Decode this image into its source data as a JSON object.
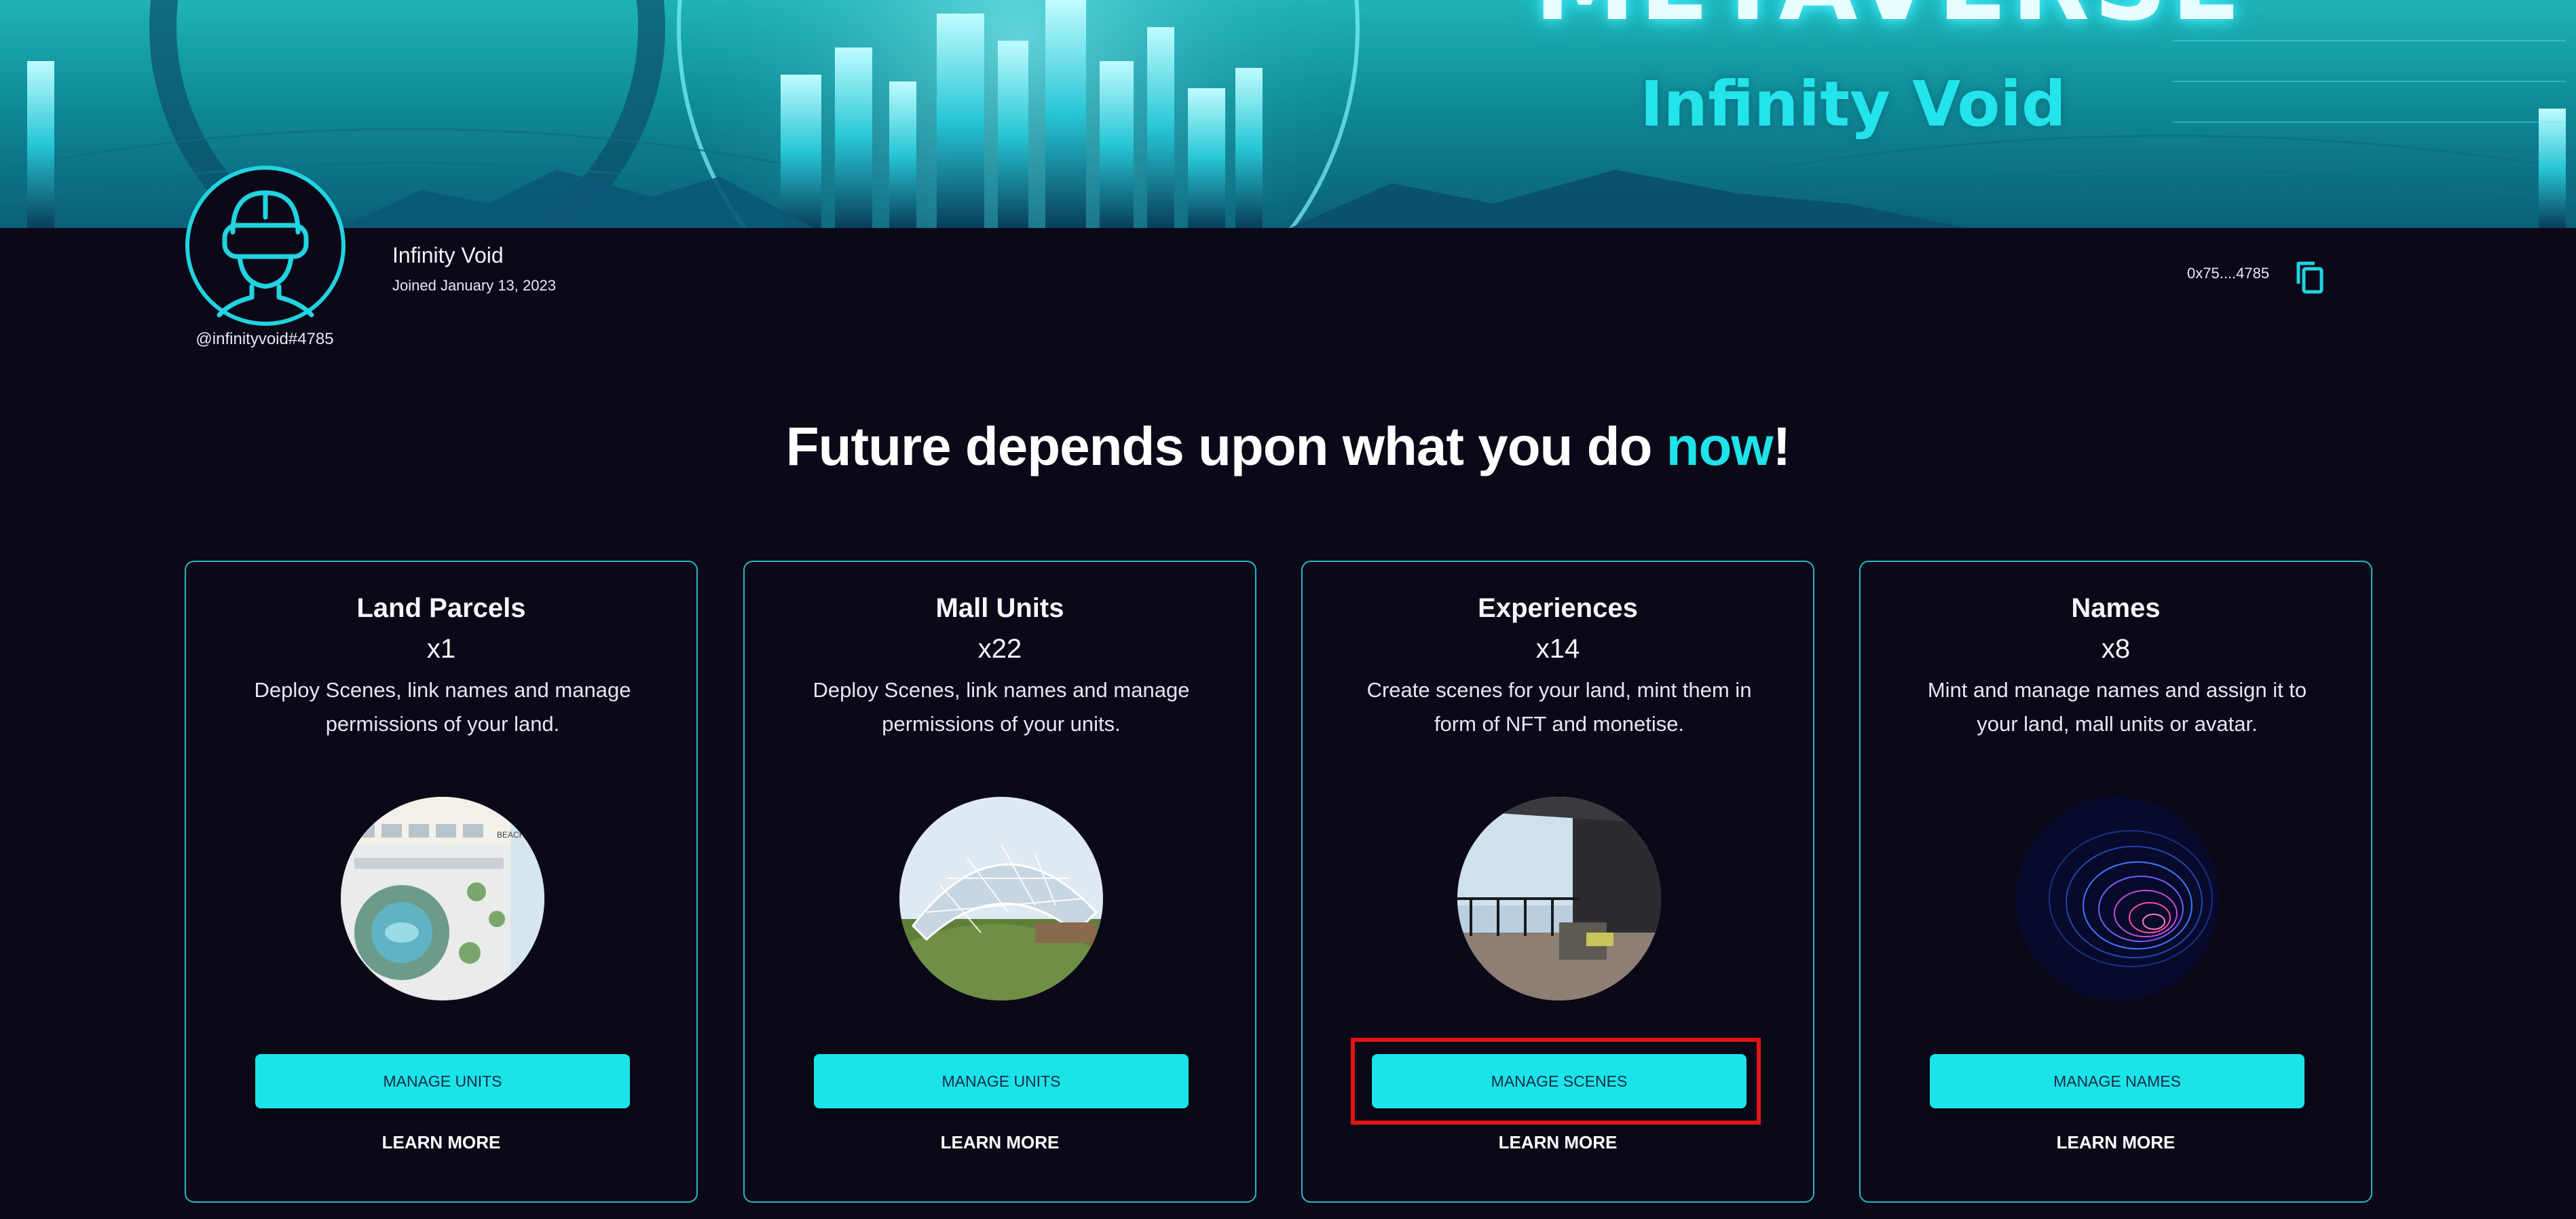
{
  "banner": {
    "word": "METAVERSE",
    "subtitle": "Infinity Void"
  },
  "profile": {
    "name": "Infinity Void",
    "joined": "Joined January 13, 2023",
    "handle": "@infinityvoid#4785",
    "wallet": "0x75....4785"
  },
  "heading": {
    "text_before": "Future depends upon what you do ",
    "accent": "now",
    "text_after": "!"
  },
  "colors": {
    "accent": "#1ae4e8",
    "background": "#0b0918",
    "card_border": "#2ab7c2",
    "highlight": "#e01616"
  },
  "cards": [
    {
      "title": "Land Parcels",
      "count": "x1",
      "description": "Deploy Scenes, link names and manage permissions of your land.",
      "button": "MANAGE UNITS",
      "learn_more": "LEARN MORE",
      "image": "land-map-image"
    },
    {
      "title": "Mall Units",
      "count": "x22",
      "description": "Deploy Scenes, link names and manage permissions of your units.",
      "button": "MANAGE UNITS",
      "learn_more": "LEARN MORE",
      "image": "glass-dome-mall-image"
    },
    {
      "title": "Experiences",
      "count": "x14",
      "description": "Create scenes for your land, mint them in form of NFT and monetise.",
      "button": "MANAGE SCENES",
      "learn_more": "LEARN MORE",
      "image": "balcony-scene-image"
    },
    {
      "title": "Names",
      "count": "x8",
      "description": "Mint and manage names and assign it to your land, mall units or avatar.",
      "button": "MANAGE NAMES",
      "learn_more": "LEARN MORE",
      "image": "neon-swirl-image"
    }
  ]
}
